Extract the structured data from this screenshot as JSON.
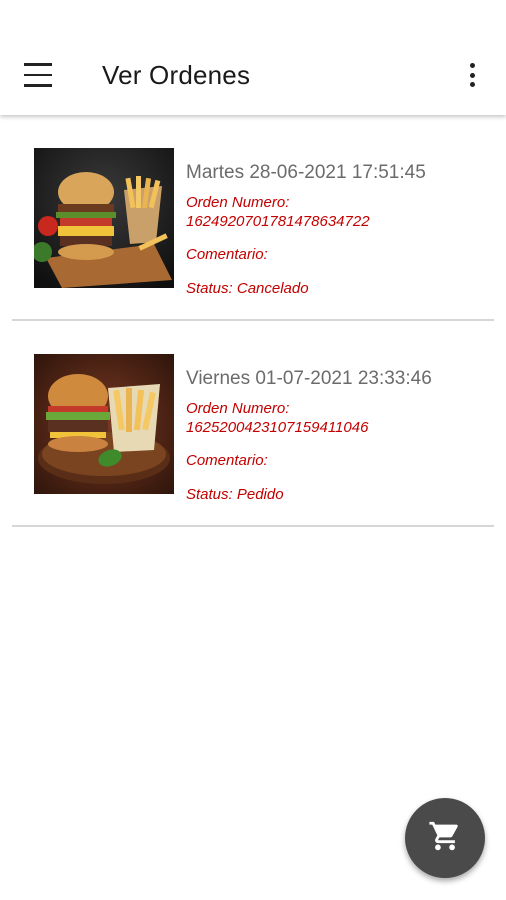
{
  "header": {
    "title": "Ver Ordenes",
    "menu_icon": "menu-icon",
    "more_icon": "more-vert-icon"
  },
  "orders": [
    {
      "date": "Martes 28-06-2021 17:51:45",
      "order_number_label": "Orden Numero:",
      "order_number": "16249207017814786347​22",
      "comment_label": "Comentario:",
      "status_label": "Status: Cancelado"
    },
    {
      "date": "Viernes 01-07-2021 23:33:46",
      "order_number_label": "Orden Numero:",
      "order_number": "16252004231071594110​46",
      "comment_label": "Comentario:",
      "status_label": "Status: Pedido"
    }
  ],
  "fab": {
    "icon": "cart-icon"
  },
  "colors": {
    "accent_red": "#c30000",
    "fab": "#4a4a4a"
  }
}
